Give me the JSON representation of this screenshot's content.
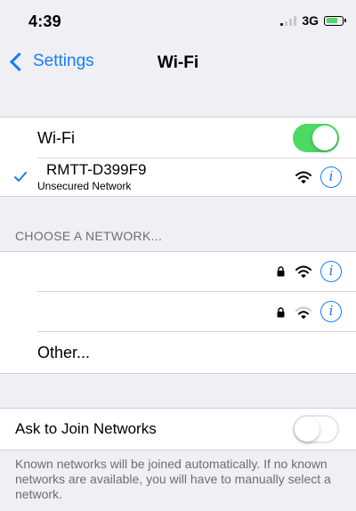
{
  "status_bar": {
    "time": "4:39",
    "network": "3G"
  },
  "nav": {
    "back_label": "Settings",
    "title": "Wi-Fi"
  },
  "wifi": {
    "label": "Wi-Fi",
    "enabled": true,
    "connected": {
      "name": "RMTT-D399F9",
      "subtitle": "Unsecured Network"
    }
  },
  "networks": {
    "header": "CHOOSE A NETWORK...",
    "items": [
      {
        "name": "",
        "locked": true
      },
      {
        "name": "",
        "locked": true
      }
    ],
    "other_label": "Other..."
  },
  "ask_to_join": {
    "label": "Ask to Join Networks",
    "enabled": false,
    "footer": "Known networks will be joined automatically. If no known networks are available, you will have to manually select a network."
  },
  "colors": {
    "accent": "#147efb",
    "toggle_on": "#4cd964",
    "background": "#efeff4"
  }
}
